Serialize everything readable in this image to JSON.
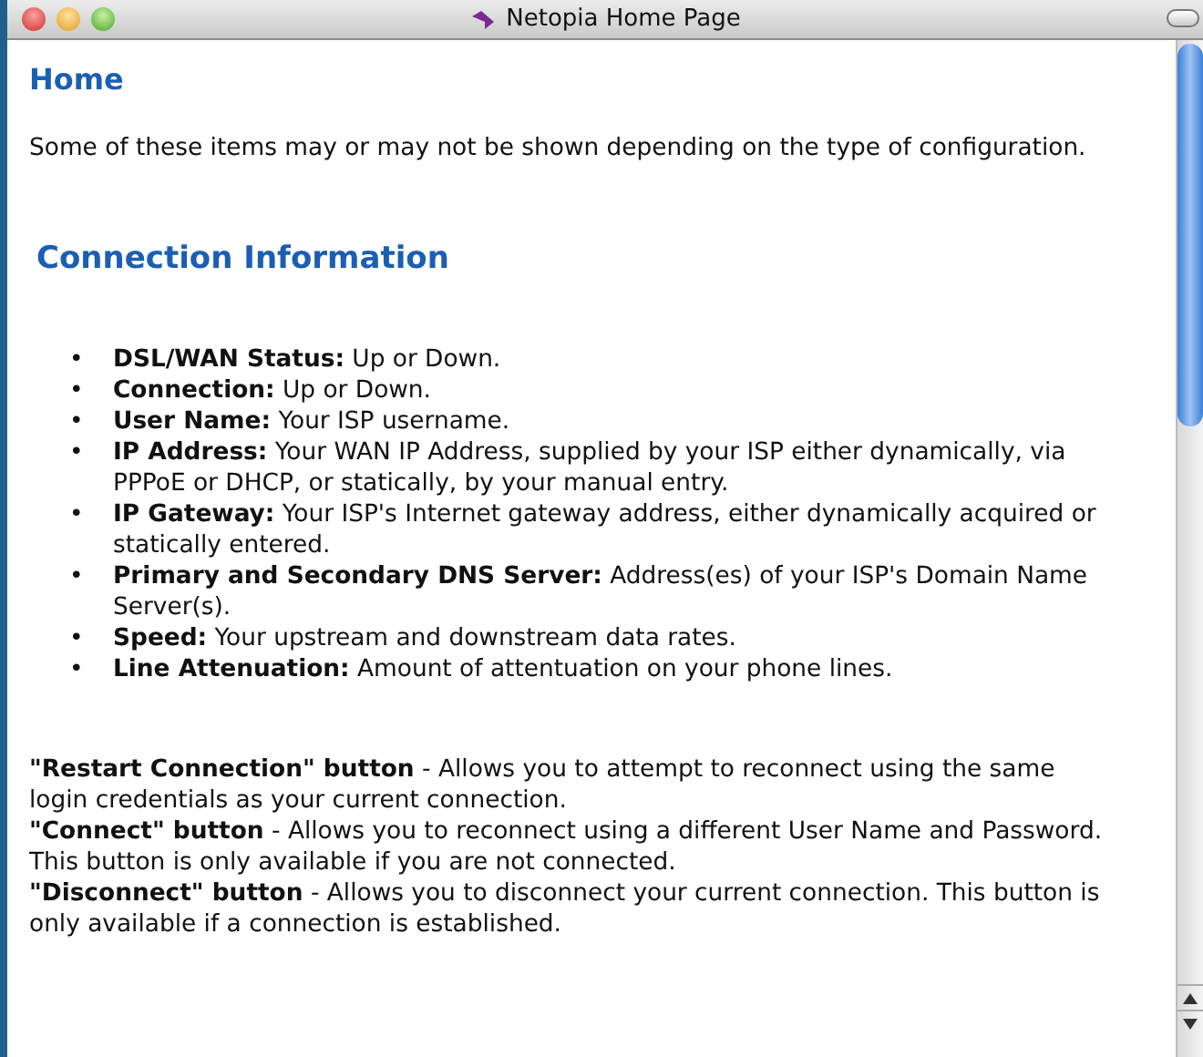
{
  "window": {
    "title": "Netopia Home Page"
  },
  "page": {
    "heading": "Home",
    "intro": "Some of these items may or may not be shown depending on the type of configuration.",
    "section_heading": "Connection Information",
    "items": [
      {
        "marker": "•",
        "text": "**DSL/WAN Status:** Up or Down."
      },
      {
        "marker": "•",
        "text": "**Connection:** Up or Down."
      },
      {
        "marker": "•",
        "text": "**User Name:** Your ISP username."
      },
      {
        "marker": "•",
        "text": "**IP Address:** Your WAN IP Address, supplied by your ISP either dynamically, via PPPoE or DHCP, or statically, by your manual entry."
      },
      {
        "marker": "•",
        "text": "**IP Gateway:** Your ISP's Internet gateway address, either dynamically acquired or statically entered."
      },
      {
        "marker": "•",
        "text": "**Primary and Secondary DNS Server:** Address(es) of your ISP's Domain Name Server(s)."
      },
      {
        "marker": "•",
        "text": "**Speed:** Your upstream and downstream data rates."
      },
      {
        "marker": "•",
        "text": "**Line Attenuation:** Amount of attentuation on your phone lines."
      }
    ],
    "button_notes": [
      "**\"Restart Connection\" button** - Allows you to attempt to reconnect using the same login credentials as your current connection.",
      "**\"Connect\" button** - Allows you to reconnect using a different User Name and Password. This button is only available if you are not connected.",
      "**\"Disconnect\" button** - Allows you to disconnect your current connection. This button is only available if a connection is established."
    ]
  }
}
